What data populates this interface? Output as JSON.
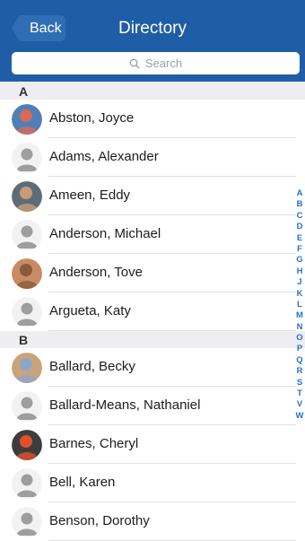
{
  "header": {
    "back_label": "Back",
    "title": "Directory"
  },
  "search": {
    "placeholder": "Search"
  },
  "sections": [
    {
      "label": "A",
      "contacts": [
        {
          "name": "Abston, Joyce",
          "photo": true,
          "colors": [
            "#d86a5a",
            "#4f7fb8"
          ]
        },
        {
          "name": "Adams, Alexander",
          "photo": false
        },
        {
          "name": "Ameen, Eddy",
          "photo": true,
          "colors": [
            "#c79c7a",
            "#5d6d75"
          ]
        },
        {
          "name": "Anderson, Michael",
          "photo": false
        },
        {
          "name": "Anderson, Tove",
          "photo": true,
          "colors": [
            "#8b5a3c",
            "#c98a66"
          ]
        },
        {
          "name": "Argueta, Katy",
          "photo": false
        }
      ]
    },
    {
      "label": "B",
      "contacts": [
        {
          "name": "Ballard, Becky",
          "photo": true,
          "colors": [
            "#8da7c9",
            "#c9a47a"
          ]
        },
        {
          "name": "Ballard-Means, Nathaniel",
          "photo": false
        },
        {
          "name": "Barnes, Cheryl",
          "photo": true,
          "colors": [
            "#e2502a",
            "#3d3d3d"
          ]
        },
        {
          "name": "Bell, Karen",
          "photo": false
        },
        {
          "name": "Benson, Dorothy",
          "photo": false
        }
      ]
    }
  ],
  "index_letters": [
    "A",
    "B",
    "C",
    "D",
    "E",
    "F",
    "G",
    "H",
    "J",
    "K",
    "L",
    "M",
    "N",
    "O",
    "P",
    "Q",
    "R",
    "S",
    "T",
    "V",
    "W"
  ],
  "colors": {
    "header": "#1f5ea6",
    "index": "#2a6fd0",
    "placeholder_avatar": "#9e9e9e"
  }
}
